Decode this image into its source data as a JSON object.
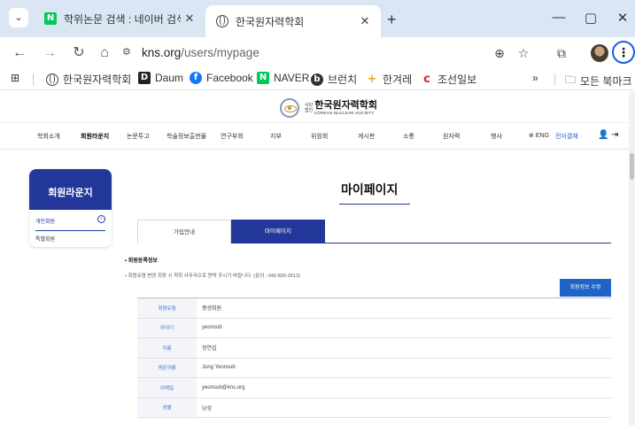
{
  "browser": {
    "tabs": [
      {
        "title": "학위논문 검색 : 네이버 검색",
        "icon": "naver-icon",
        "active": false
      },
      {
        "title": "한국원자력학회",
        "icon": "globe-icon",
        "active": true
      }
    ],
    "url_host": "kns.org",
    "url_path": "/users/mypage",
    "bookmarks": [
      {
        "label": "한국원자력학회",
        "icon": "globe-icon"
      },
      {
        "label": "Daum",
        "icon": "daum-icon",
        "glyph": "D",
        "color": "#222222"
      },
      {
        "label": "Facebook",
        "icon": "facebook-icon",
        "glyph": "f",
        "color": "#1877f2"
      },
      {
        "label": "NAVER",
        "icon": "naver-icon",
        "glyph": "N",
        "color": "#03c75a"
      },
      {
        "label": "브런치",
        "icon": "brunch-icon",
        "glyph": "b",
        "color": "#333333"
      },
      {
        "label": "한겨레",
        "icon": "hani-icon",
        "glyph": "+",
        "color": "#f5a623"
      },
      {
        "label": "조선일보",
        "icon": "chosun-icon",
        "glyph": "c",
        "color": "#e02020"
      }
    ],
    "more_bookmarks_chevron": "»",
    "all_bookmarks": "모든 북마크"
  },
  "site": {
    "logo": {
      "small_left": "사단\n법인",
      "name": "한국원자력학회",
      "sub": "KOREAN NUCLEAR SOCIETY"
    },
    "nav": [
      "학회소개",
      "회원라운지",
      "논문투고",
      "학술정보출판물",
      "연구부회",
      "지부",
      "위원회",
      "게시판",
      "소통",
      "원자력",
      "행사"
    ],
    "nav_active": "회원라운지",
    "lang": "ENG",
    "epay": "전자결재"
  },
  "sidebar": {
    "title": "회원라운지",
    "items": [
      {
        "label": "개인회원",
        "active": true
      },
      {
        "label": "특별회원",
        "active": false
      }
    ]
  },
  "main": {
    "title": "마이페이지",
    "tabs": [
      {
        "label": "가입안내",
        "active": false
      },
      {
        "label": "마이페이지",
        "active": true
      }
    ],
    "section_title": "• 회원등록정보",
    "section_note": "• 회원유형 변경 회망 시 학회 사무국으로 연락 주시기 바랍니다. (문의 : 042-826-2613)",
    "edit_button": "회원정보 수정",
    "rows": [
      {
        "label": "회원유형",
        "value": "평생회원"
      },
      {
        "label": "아이디",
        "value": "yeonsub"
      },
      {
        "label": "이름",
        "value": "정연섭"
      },
      {
        "label": "영문이름",
        "value": "Jung Yeonsub"
      },
      {
        "label": "이메일",
        "value": "yeonsub@kns.org"
      },
      {
        "label": "성별",
        "value": "남성"
      }
    ]
  },
  "colors": {
    "primary": "#23379a",
    "button": "#1f63c6",
    "label": "#3a6fc8",
    "tabbar": "#dbe6f4"
  }
}
